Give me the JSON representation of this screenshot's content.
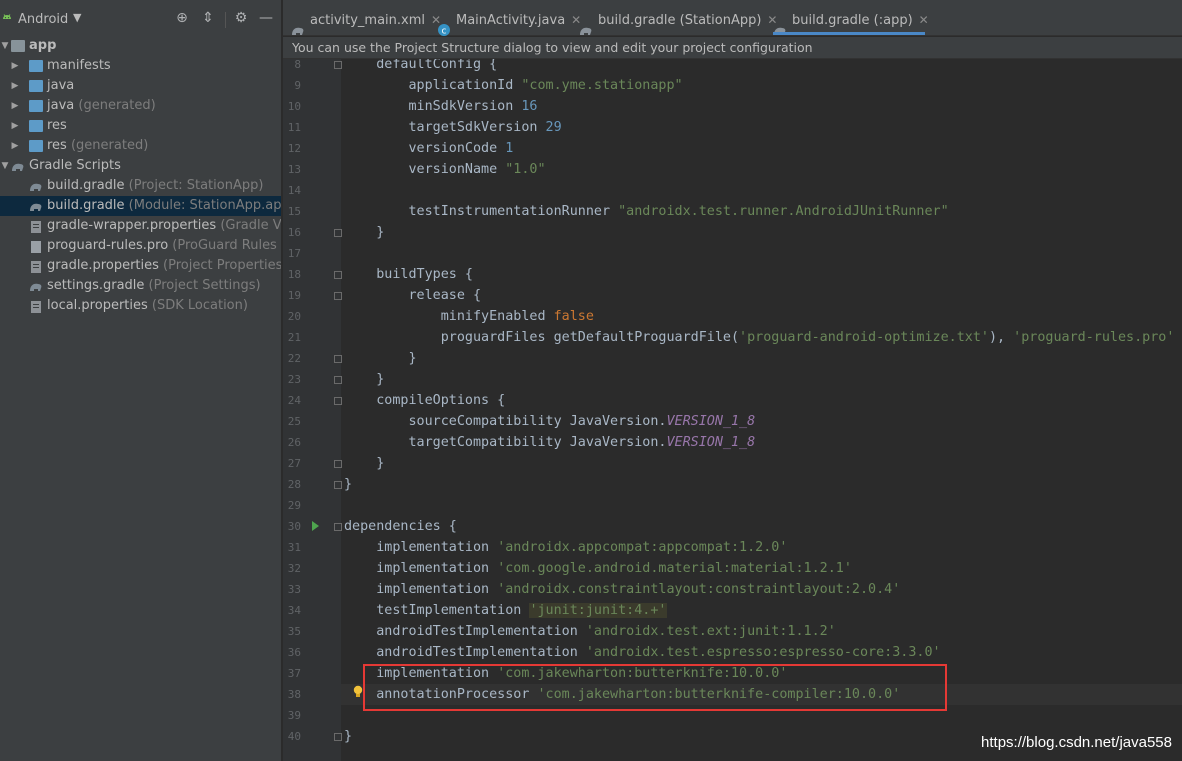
{
  "sidebar": {
    "view_title": "Android",
    "tree": [
      {
        "name": "app",
        "sub": "",
        "indent": 0,
        "expanded": true,
        "icon": "module"
      },
      {
        "name": "manifests",
        "sub": "",
        "indent": 1,
        "expanded": false,
        "icon": "folder"
      },
      {
        "name": "java",
        "sub": "",
        "indent": 1,
        "expanded": false,
        "icon": "folder"
      },
      {
        "name": "java",
        "sub": "(generated)",
        "indent": 1,
        "expanded": false,
        "icon": "folder"
      },
      {
        "name": "res",
        "sub": "",
        "indent": 1,
        "expanded": false,
        "icon": "folder"
      },
      {
        "name": "res",
        "sub": "(generated)",
        "indent": 1,
        "expanded": false,
        "icon": "folder"
      },
      {
        "name": "Gradle Scripts",
        "sub": "",
        "indent": 0,
        "expanded": true,
        "icon": "gradle"
      },
      {
        "name": "build.gradle",
        "sub": "(Project: StationApp)",
        "indent": 1,
        "icon": "gradle"
      },
      {
        "name": "build.gradle",
        "sub": "(Module: StationApp.app)",
        "indent": 1,
        "icon": "gradle",
        "selected": true
      },
      {
        "name": "gradle-wrapper.properties",
        "sub": "(Gradle Vers",
        "indent": 1,
        "icon": "props"
      },
      {
        "name": "proguard-rules.pro",
        "sub": "(ProGuard Rules for",
        "indent": 1,
        "icon": "file"
      },
      {
        "name": "gradle.properties",
        "sub": "(Project Properties)",
        "indent": 1,
        "icon": "props"
      },
      {
        "name": "settings.gradle",
        "sub": "(Project Settings)",
        "indent": 1,
        "icon": "gradle"
      },
      {
        "name": "local.properties",
        "sub": "(SDK Location)",
        "indent": 1,
        "icon": "props"
      }
    ]
  },
  "tabs": [
    {
      "label": "activity_main.xml",
      "icon": "xml-icon"
    },
    {
      "label": "MainActivity.java",
      "icon": "class-icon"
    },
    {
      "label": "build.gradle (StationApp)",
      "icon": "gradle-icon"
    },
    {
      "label": "build.gradle (:app)",
      "icon": "gradle-icon",
      "active": true
    }
  ],
  "banner": "You can use the Project Structure dialog to view and edit your project configuration",
  "editor": {
    "lines": [
      {
        "n": 8,
        "tokens": [
          [
            "k",
            "    defaultConfig {"
          ]
        ]
      },
      {
        "n": 9,
        "tokens": [
          [
            "k",
            "        applicationId "
          ],
          [
            "s",
            "\"com.yme.stationapp\""
          ]
        ]
      },
      {
        "n": 10,
        "tokens": [
          [
            "k",
            "        minSdkVersion "
          ],
          [
            "n",
            "16"
          ]
        ]
      },
      {
        "n": 11,
        "tokens": [
          [
            "k",
            "        targetSdkVersion "
          ],
          [
            "n",
            "29"
          ]
        ]
      },
      {
        "n": 12,
        "tokens": [
          [
            "k",
            "        versionCode "
          ],
          [
            "n",
            "1"
          ]
        ]
      },
      {
        "n": 13,
        "tokens": [
          [
            "k",
            "        versionName "
          ],
          [
            "s",
            "\"1.0\""
          ]
        ]
      },
      {
        "n": 14,
        "tokens": []
      },
      {
        "n": 15,
        "tokens": [
          [
            "k",
            "        testInstrumentationRunner "
          ],
          [
            "s",
            "\"androidx.test.runner.AndroidJUnitRunner\""
          ]
        ]
      },
      {
        "n": 16,
        "tokens": [
          [
            "k",
            "    }"
          ]
        ]
      },
      {
        "n": 17,
        "tokens": []
      },
      {
        "n": 18,
        "tokens": [
          [
            "k",
            "    buildTypes {"
          ]
        ]
      },
      {
        "n": 19,
        "tokens": [
          [
            "k",
            "        release {"
          ]
        ]
      },
      {
        "n": 20,
        "tokens": [
          [
            "k",
            "            minifyEnabled "
          ],
          [
            "kw",
            "false"
          ]
        ]
      },
      {
        "n": 21,
        "tokens": [
          [
            "k",
            "            proguardFiles getDefaultProguardFile("
          ],
          [
            "s",
            "'proguard-android-optimize.txt'"
          ],
          [
            "k",
            "), "
          ],
          [
            "s",
            "'proguard-rules.pro'"
          ]
        ]
      },
      {
        "n": 22,
        "tokens": [
          [
            "k",
            "        }"
          ]
        ]
      },
      {
        "n": 23,
        "tokens": [
          [
            "k",
            "    }"
          ]
        ]
      },
      {
        "n": 24,
        "tokens": [
          [
            "k",
            "    compileOptions {"
          ]
        ]
      },
      {
        "n": 25,
        "tokens": [
          [
            "k",
            "        sourceCompatibility JavaVersion."
          ],
          [
            "it",
            "VERSION_1_8"
          ]
        ]
      },
      {
        "n": 26,
        "tokens": [
          [
            "k",
            "        targetCompatibility JavaVersion."
          ],
          [
            "it",
            "VERSION_1_8"
          ]
        ]
      },
      {
        "n": 27,
        "tokens": [
          [
            "k",
            "    }"
          ]
        ]
      },
      {
        "n": 28,
        "tokens": [
          [
            "k",
            "}"
          ]
        ]
      },
      {
        "n": 29,
        "tokens": []
      },
      {
        "n": 30,
        "tokens": [
          [
            "k",
            "dependencies {"
          ]
        ]
      },
      {
        "n": 31,
        "tokens": [
          [
            "k",
            "    implementation "
          ],
          [
            "s",
            "'androidx.appcompat:appcompat:1.2.0'"
          ]
        ]
      },
      {
        "n": 32,
        "tokens": [
          [
            "k",
            "    implementation "
          ],
          [
            "s",
            "'com.google.android.material:material:1.2.1'"
          ]
        ]
      },
      {
        "n": 33,
        "tokens": [
          [
            "k",
            "    implementation "
          ],
          [
            "s",
            "'androidx.constraintlayout:constraintlayout:2.0.4'"
          ]
        ]
      },
      {
        "n": 34,
        "tokens": [
          [
            "k",
            "    testImplementation "
          ],
          [
            "s hl",
            "'junit:junit:4.+'"
          ]
        ]
      },
      {
        "n": 35,
        "tokens": [
          [
            "k",
            "    androidTestImplementation "
          ],
          [
            "s",
            "'androidx.test.ext:junit:1.1.2'"
          ]
        ]
      },
      {
        "n": 36,
        "tokens": [
          [
            "k",
            "    androidTestImplementation "
          ],
          [
            "s",
            "'androidx.test.espresso:espresso-core:3.3.0'"
          ]
        ]
      },
      {
        "n": 37,
        "tokens": [
          [
            "k",
            "    implementation "
          ],
          [
            "s",
            "'com.jakewharton:butterknife:10.0.0'"
          ]
        ]
      },
      {
        "n": 38,
        "tokens": [
          [
            "k",
            "    annotationProcessor "
          ],
          [
            "s",
            "'com.jakewharton:butterknife-compiler:10.0.0'"
          ]
        ]
      },
      {
        "n": 39,
        "tokens": []
      },
      {
        "n": 40,
        "tokens": [
          [
            "k",
            "}"
          ]
        ]
      }
    ],
    "current_line": 38
  },
  "watermark": "https://blog.csdn.net/java558",
  "colors": {
    "accent": "#4a88c7",
    "highlight_box": "#e53935",
    "string": "#6a8759",
    "number": "#6897bb",
    "keyword": "#cc7832"
  }
}
